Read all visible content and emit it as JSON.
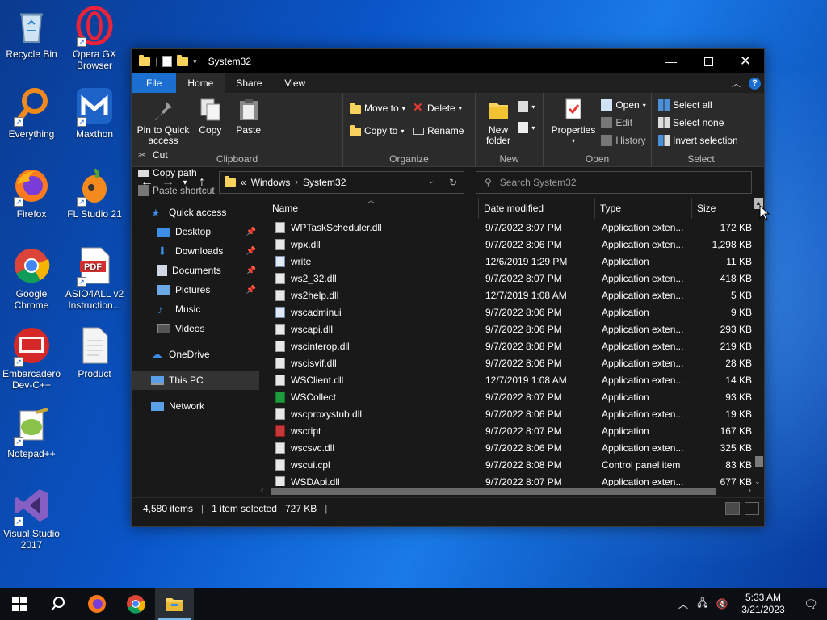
{
  "desktop": {
    "icons": [
      {
        "label": "Recycle Bin",
        "icon": "recycle-bin-icon"
      },
      {
        "label": "Opera GX Browser",
        "icon": "opera-gx-icon"
      },
      {
        "label": "Everything",
        "icon": "everything-search-icon"
      },
      {
        "label": "Maxthon",
        "icon": "maxthon-icon"
      },
      {
        "label": "Firefox",
        "icon": "firefox-icon"
      },
      {
        "label": "FL Studio 21",
        "icon": "fl-studio-icon"
      },
      {
        "label": "Google Chrome",
        "icon": "chrome-icon"
      },
      {
        "label": "ASIO4ALL v2 Instruction...",
        "icon": "pdf-icon"
      },
      {
        "label": "Embarcadero Dev-C++",
        "icon": "dev-cpp-icon"
      },
      {
        "label": "Product",
        "icon": "document-icon"
      },
      {
        "label": "Notepad++",
        "icon": "notepad-plus-plus-icon"
      },
      {
        "label": "Visual Studio 2017",
        "icon": "visual-studio-icon"
      }
    ]
  },
  "window": {
    "title": "System32",
    "tabs": {
      "file": "File",
      "home": "Home",
      "share": "Share",
      "view": "View"
    },
    "help": "?"
  },
  "ribbon": {
    "clipboard": {
      "label": "Clipboard",
      "pin": "Pin to Quick access",
      "copy": "Copy",
      "paste": "Paste",
      "cut": "Cut",
      "copy_path": "Copy path",
      "paste_shortcut": "Paste shortcut"
    },
    "organize": {
      "label": "Organize",
      "move_to": "Move to",
      "copy_to": "Copy to",
      "delete": "Delete",
      "rename": "Rename"
    },
    "new": {
      "label": "New",
      "new_folder": "New folder"
    },
    "open": {
      "label": "Open",
      "properties": "Properties",
      "open": "Open",
      "edit": "Edit",
      "history": "History"
    },
    "select": {
      "label": "Select",
      "select_all": "Select all",
      "select_none": "Select none",
      "invert": "Invert selection"
    }
  },
  "address": {
    "overflow": "«",
    "crumbs": [
      "Windows",
      "System32"
    ],
    "search_placeholder": "Search System32"
  },
  "nav": {
    "quick_access": "Quick access",
    "items": [
      "Desktop",
      "Downloads",
      "Documents",
      "Pictures",
      "Music",
      "Videos"
    ],
    "onedrive": "OneDrive",
    "this_pc": "This PC",
    "network": "Network"
  },
  "columns": {
    "name": "Name",
    "date": "Date modified",
    "type": "Type",
    "size": "Size"
  },
  "files": [
    {
      "name": "WPTaskScheduler.dll",
      "date": "9/7/2022 8:07 PM",
      "type": "Application exten...",
      "size": "172 KB"
    },
    {
      "name": "wpx.dll",
      "date": "9/7/2022 8:06 PM",
      "type": "Application exten...",
      "size": "1,298 KB"
    },
    {
      "name": "write",
      "date": "12/6/2019 1:29 PM",
      "type": "Application",
      "size": "11 KB"
    },
    {
      "name": "ws2_32.dll",
      "date": "9/7/2022 8:07 PM",
      "type": "Application exten...",
      "size": "418 KB"
    },
    {
      "name": "ws2help.dll",
      "date": "12/7/2019 1:08 AM",
      "type": "Application exten...",
      "size": "5 KB"
    },
    {
      "name": "wscadminui",
      "date": "9/7/2022 8:06 PM",
      "type": "Application",
      "size": "9 KB"
    },
    {
      "name": "wscapi.dll",
      "date": "9/7/2022 8:06 PM",
      "type": "Application exten...",
      "size": "293 KB"
    },
    {
      "name": "wscinterop.dll",
      "date": "9/7/2022 8:08 PM",
      "type": "Application exten...",
      "size": "219 KB"
    },
    {
      "name": "wscisvif.dll",
      "date": "9/7/2022 8:06 PM",
      "type": "Application exten...",
      "size": "28 KB"
    },
    {
      "name": "WSClient.dll",
      "date": "12/7/2019 1:08 AM",
      "type": "Application exten...",
      "size": "14 KB"
    },
    {
      "name": "WSCollect",
      "date": "9/7/2022 8:07 PM",
      "type": "Application",
      "size": "93 KB"
    },
    {
      "name": "wscproxystub.dll",
      "date": "9/7/2022 8:06 PM",
      "type": "Application exten...",
      "size": "19 KB"
    },
    {
      "name": "wscript",
      "date": "9/7/2022 8:07 PM",
      "type": "Application",
      "size": "167 KB"
    },
    {
      "name": "wscsvc.dll",
      "date": "9/7/2022 8:06 PM",
      "type": "Application exten...",
      "size": "325 KB"
    },
    {
      "name": "wscui.cpl",
      "date": "9/7/2022 8:08 PM",
      "type": "Control panel item",
      "size": "83 KB"
    },
    {
      "name": "WSDApi.dll",
      "date": "9/7/2022 8:07 PM",
      "type": "Application exten...",
      "size": "677 KB"
    }
  ],
  "status": {
    "count": "4,580 items",
    "selected": "1 item selected",
    "size": "727 KB"
  },
  "taskbar": {
    "time": "5:33 AM",
    "date": "3/21/2023"
  },
  "colors": {
    "accent": "#1b6fd1",
    "window_bg": "#191919",
    "ribbon_bg": "#2b2b2b",
    "folder": "#f7d25c"
  }
}
